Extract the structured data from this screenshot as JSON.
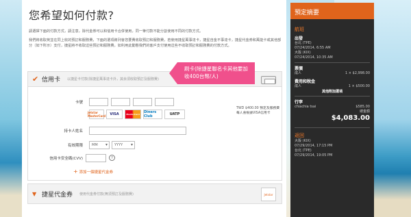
{
  "page": {
    "title": "您希望如何付款?",
    "intro": [
      "請選擇下面的付款方式，請注意，除代金券可以和信用卡合併使用，同一筆付款不能分割使用不同的付款方式。",
      "我們將收取英並在同上收的預訂和服務費，下面的選項將列會您要費收取預訂和服務費，若使用捷星萬事達卡，捷星自金不事達卡，捷星代金券和萬能卡或其他部分（如下所示）支付，捷星將不收取這些預訂和服務費，如利用此動態我們的客戶支付使用這些不收取預訂和服務費的付款方式。"
    ]
  },
  "credit_card": {
    "title": "信用卡",
    "subtitle": "以捷星卡付款(除捷星萬事達卡外，其余須收取預訂及服務費)",
    "card_number_label": "卡號",
    "logos": [
      "Jetstar MasterCard",
      "VISA",
      "MasterCard",
      "Diners Club",
      "UATP"
    ],
    "fee_note": "TWD $400.00 預定及服務費每人會根據VISA信用卡",
    "holder_label": "持卡人姓名",
    "expiry_label": "有效期限",
    "expiry_month": "MM",
    "expiry_year": "YYYY",
    "cvv_label": "信用卡安全碼(CVV)",
    "promo": "刷卡(除捷星聯名卡其他要加收400台幣/人)",
    "add_voucher": "添加一個捷星代金券"
  },
  "voucher": {
    "title": "捷星代金券",
    "subtitle": "使用代金券付款(無須預訂及服務費)"
  },
  "summary": {
    "header": "預定摘要",
    "flight_title": "航班",
    "outbound": "出發",
    "out_from": "台北 (TPE)",
    "out_from_time": "07/24/2014, 6:55 AM",
    "out_to": "大阪 (KIX)",
    "out_to_time": "07/24/2014, 10:35 AM",
    "fare_label": "票價",
    "adult_label": "成人",
    "adult_value": "1 × $2,998.00",
    "fees_label": "費用和稅金",
    "adult2_label": "成人",
    "adult2_value": "1 × $500.00",
    "extras_label": "其他附加選項",
    "passenger_label": "行李",
    "passenger_name": "chiachia tsai",
    "passenger_value": "$585.00",
    "total_label": "總金額",
    "total_value": "$4,083.00",
    "return_title": "返回",
    "ret_from": "大阪 (KIX)",
    "ret_from_time": "07/29/2014, 17:15 PM",
    "ret_to": "台北 (TPE)",
    "ret_to_time": "07/29/2014, 19:05 PM"
  }
}
